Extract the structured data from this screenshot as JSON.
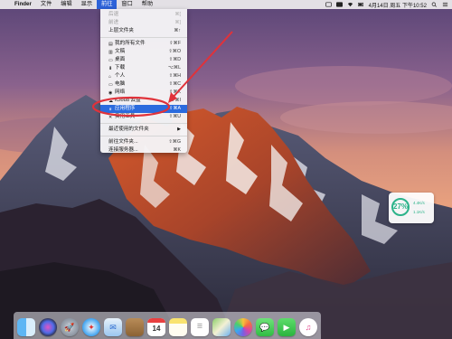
{
  "menubar": {
    "apple": "",
    "app_name": "Finder",
    "items": [
      "文件",
      "编辑",
      "显示",
      "前往",
      "窗口",
      "帮助"
    ],
    "active_index": 3,
    "datetime": "4月14日 周五 下午10:52"
  },
  "go_menu": {
    "items": [
      {
        "label": "后退",
        "shortcut": "⌘[",
        "dim": true
      },
      {
        "label": "前进",
        "shortcut": "⌘]",
        "dim": true
      },
      {
        "label": "上层文件夹",
        "shortcut": "⌘↑"
      },
      {
        "sep": true
      },
      {
        "label": "我的所有文件",
        "shortcut": "⇧⌘F",
        "icon": "all-files-icon"
      },
      {
        "label": "文稿",
        "shortcut": "⇧⌘O",
        "icon": "documents-icon"
      },
      {
        "label": "桌面",
        "shortcut": "⇧⌘D",
        "icon": "desktop-icon"
      },
      {
        "label": "下载",
        "shortcut": "⌥⌘L",
        "icon": "downloads-icon"
      },
      {
        "label": "个人",
        "shortcut": "⇧⌘H",
        "icon": "home-icon"
      },
      {
        "label": "电脑",
        "shortcut": "⇧⌘C",
        "icon": "computer-icon"
      },
      {
        "label": "网络",
        "shortcut": "⇧⌘K",
        "icon": "network-icon"
      },
      {
        "label": "iCloud 云盘",
        "shortcut": "⇧⌘I",
        "icon": "icloud-icon"
      },
      {
        "label": "应用程序",
        "shortcut": "⇧⌘A",
        "icon": "applications-icon",
        "selected": true
      },
      {
        "label": "实用工具",
        "shortcut": "⇧⌘U",
        "icon": "utilities-icon"
      },
      {
        "sep": true
      },
      {
        "label": "最近使用的文件夹",
        "submenu": true
      },
      {
        "sep": true
      },
      {
        "label": "前往文件夹...",
        "shortcut": "⇧⌘G"
      },
      {
        "label": "连接服务器...",
        "shortcut": "⌘K"
      }
    ]
  },
  "widget": {
    "value": "27%",
    "line1_label": "",
    "line1_value": "4.4K/s",
    "line2_label": "",
    "line2_value": "1.1K/s"
  },
  "dock": {
    "calendar_day": "14",
    "icons": [
      "finder-icon",
      "siri-icon",
      "launchpad-icon",
      "safari-icon",
      "mail-icon",
      "contacts-icon",
      "calendar-icon",
      "notes-icon",
      "reminders-icon",
      "maps-icon",
      "photos-icon",
      "messages-icon",
      "facetime-icon",
      "itunes-icon",
      "ibooks-icon"
    ]
  },
  "colors": {
    "menu_highlight": "#2b6bde",
    "annotation": "#e0323a",
    "widget_green": "#2cb38a"
  }
}
